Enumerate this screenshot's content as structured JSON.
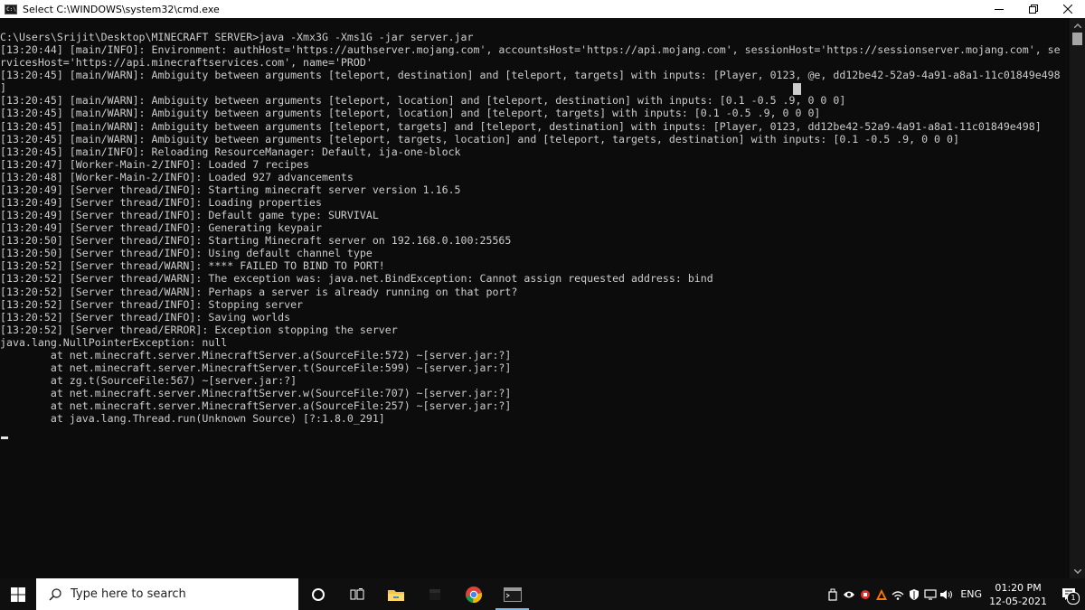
{
  "window": {
    "title": "Select C:\\WINDOWS\\system32\\cmd.exe",
    "icon": "cmd-icon",
    "controls": [
      "minimize",
      "restore",
      "close"
    ]
  },
  "console": {
    "lines": [
      "C:\\Users\\Srijit\\Desktop\\MINECRAFT SERVER>java -Xmx3G -Xms1G -jar server.jar",
      "[13:20:44] [main/INFO]: Environment: authHost='https://authserver.mojang.com', accountsHost='https://api.mojang.com', sessionHost='https://sessionserver.mojang.com', se",
      "rvicesHost='https://api.minecraftservices.com', name='PROD'",
      "[13:20:45] [main/WARN]: Ambiguity between arguments [teleport, destination] and [teleport, targets] with inputs: [Player, 0123, @e, dd12be42-52a9-4a91-a8a1-11c01849e498",
      "]",
      "[13:20:45] [main/WARN]: Ambiguity between arguments [teleport, location] and [teleport, destination] with inputs: [0.1 -0.5 .9, 0 0 0]",
      "[13:20:45] [main/WARN]: Ambiguity between arguments [teleport, location] and [teleport, targets] with inputs: [0.1 -0.5 .9, 0 0 0]",
      "[13:20:45] [main/WARN]: Ambiguity between arguments [teleport, targets] and [teleport, destination] with inputs: [Player, 0123, dd12be42-52a9-4a91-a8a1-11c01849e498]",
      "[13:20:45] [main/WARN]: Ambiguity between arguments [teleport, targets, location] and [teleport, targets, destination] with inputs: [0.1 -0.5 .9, 0 0 0]",
      "[13:20:45] [main/INFO]: Reloading ResourceManager: Default, ija-one-block",
      "[13:20:47] [Worker-Main-2/INFO]: Loaded 7 recipes",
      "[13:20:48] [Worker-Main-2/INFO]: Loaded 927 advancements",
      "[13:20:49] [Server thread/INFO]: Starting minecraft server version 1.16.5",
      "[13:20:49] [Server thread/INFO]: Loading properties",
      "[13:20:49] [Server thread/INFO]: Default game type: SURVIVAL",
      "[13:20:49] [Server thread/INFO]: Generating keypair",
      "[13:20:50] [Server thread/INFO]: Starting Minecraft server on 192.168.0.100:25565",
      "[13:20:50] [Server thread/INFO]: Using default channel type",
      "[13:20:52] [Server thread/WARN]: **** FAILED TO BIND TO PORT!",
      "[13:20:52] [Server thread/WARN]: The exception was: java.net.BindException: Cannot assign requested address: bind",
      "[13:20:52] [Server thread/WARN]: Perhaps a server is already running on that port?",
      "[13:20:52] [Server thread/INFO]: Stopping server",
      "[13:20:52] [Server thread/INFO]: Saving worlds",
      "[13:20:52] [Server thread/ERROR]: Exception stopping the server",
      "java.lang.NullPointerException: null",
      "        at net.minecraft.server.MinecraftServer.a(SourceFile:572) ~[server.jar:?]",
      "        at net.minecraft.server.MinecraftServer.t(SourceFile:599) ~[server.jar:?]",
      "        at zg.t(SourceFile:567) ~[server.jar:?]",
      "        at net.minecraft.server.MinecraftServer.w(SourceFile:707) ~[server.jar:?]",
      "        at net.minecraft.server.MinecraftServer.a(SourceFile:257) ~[server.jar:?]",
      "        at java.lang.Thread.run(Unknown Source) [?:1.8.0_291]"
    ]
  },
  "taskbar": {
    "search_placeholder": "Type here to search",
    "pinned": [
      "cortana-icon",
      "task-view-icon",
      "file-explorer-icon",
      "minecraft-icon",
      "chrome-icon",
      "cmd-icon"
    ],
    "tray": {
      "icons": [
        "usb-icon",
        "nvidia-icon",
        "tray-app-icon",
        "avast-icon",
        "network-icon",
        "security-icon",
        "display-icon",
        "volume-icon"
      ],
      "language": "ENG",
      "time": "01:20 PM",
      "date": "12-05-2021",
      "notification_count": "1"
    }
  },
  "colors": {
    "console_bg": "#0c0c0c",
    "console_text": "#cccccc",
    "titlebar_bg": "#ffffff",
    "taskbar_bg": "#0f0f0f",
    "active_indicator": "#76b9ed"
  }
}
